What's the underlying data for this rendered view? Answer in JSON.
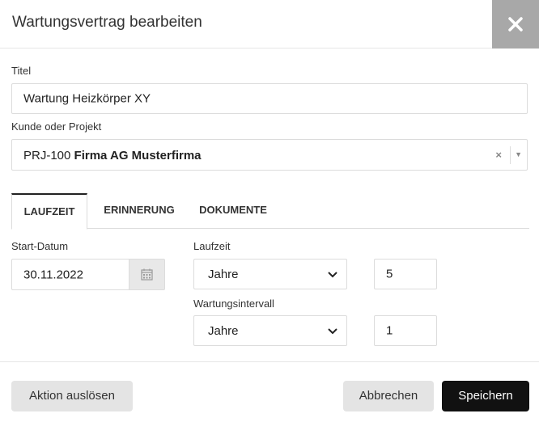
{
  "dialog": {
    "title": "Wartungsvertrag bearbeiten"
  },
  "form": {
    "title_label": "Titel",
    "title_value": "Wartung Heizkörper XY",
    "customer_label": "Kunde oder Projekt",
    "customer_prefix": "PRJ-100",
    "customer_name": "Firma AG Musterfirma",
    "clear_symbol": "×",
    "dropdown_caret": "▼"
  },
  "tabs": [
    {
      "label": "LAUFZEIT",
      "active": true
    },
    {
      "label": "ERINNERUNG",
      "active": false
    },
    {
      "label": "DOKUMENTE",
      "active": false
    }
  ],
  "laufzeit": {
    "start_label": "Start-Datum",
    "start_value": "30.11.2022",
    "duration_label": "Laufzeit",
    "duration_unit": "Jahre",
    "duration_value": "5",
    "interval_label": "Wartungsintervall",
    "interval_unit": "Jahre",
    "interval_value": "1"
  },
  "footer": {
    "action_label": "Aktion auslösen",
    "cancel_label": "Abbrechen",
    "save_label": "Speichern"
  },
  "colors": {
    "close_bg": "#a8a8a8",
    "save_bg": "#111111",
    "secondary_bg": "#e4e4e4"
  }
}
